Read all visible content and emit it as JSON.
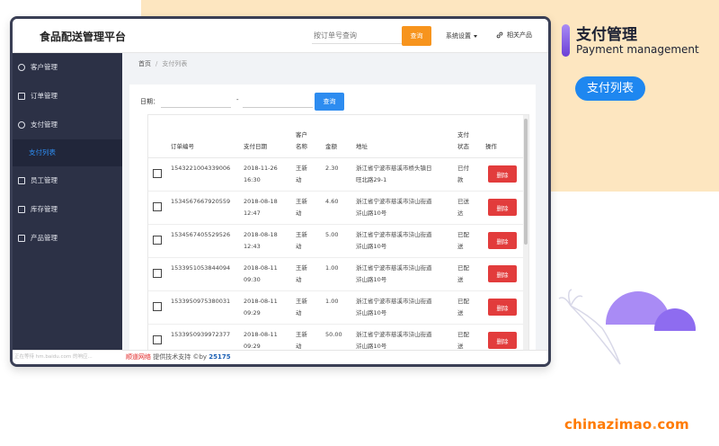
{
  "app": {
    "brand": "食品配送管理平台",
    "search_placeholder": "按订单号查询",
    "search_button": "查询",
    "system_settings": "系统设置",
    "related_products": "相关产品"
  },
  "sidebar": {
    "items": [
      {
        "label": "客户管理",
        "icon": "user-icon"
      },
      {
        "label": "订单管理",
        "icon": "document-icon"
      },
      {
        "label": "支付管理",
        "icon": "payment-icon"
      },
      {
        "label": "员工管理",
        "icon": "id-card-icon"
      },
      {
        "label": "库存管理",
        "icon": "home-icon"
      },
      {
        "label": "产品管理",
        "icon": "grid-icon"
      }
    ],
    "active_sub": "支付列表"
  },
  "breadcrumb": {
    "home": "首页",
    "sep": "/",
    "current": "支付列表"
  },
  "filter": {
    "date_label": "日期：",
    "dash": "-",
    "query_button": "查询"
  },
  "table": {
    "headers": {
      "order_no": "订单编号",
      "pay_date": "支付日期",
      "customer_l1": "客户",
      "customer_l2": "名称",
      "amount": "金额",
      "address": "地址",
      "status_l1": "支付",
      "status_l2": "状态",
      "action": "操作"
    },
    "rows": [
      {
        "order_no": "1543221004339006",
        "date": "2018-11-26",
        "time": "16:30",
        "name_l1": "王新",
        "name_l2": "动",
        "amount": "2.30",
        "addr_l1": "浙江省宁波市慈溪市桥头镇日",
        "addr_l2": "旺北路29-1",
        "status_l1": "已付",
        "status_l2": "款",
        "action": "删除"
      },
      {
        "order_no": "1534567667920559",
        "date": "2018-08-18",
        "time": "12:47",
        "name_l1": "王新",
        "name_l2": "动",
        "amount": "4.60",
        "addr_l1": "浙江省宁波市慈溪市浒山街道",
        "addr_l2": "浒山路10号",
        "status_l1": "已送",
        "status_l2": "达",
        "action": "删除"
      },
      {
        "order_no": "1534567405529526",
        "date": "2018-08-18",
        "time": "12:43",
        "name_l1": "王新",
        "name_l2": "动",
        "amount": "5.00",
        "addr_l1": "浙江省宁波市慈溪市浒山街道",
        "addr_l2": "浒山路10号",
        "status_l1": "已配",
        "status_l2": "送",
        "action": "删除"
      },
      {
        "order_no": "1533951053844094",
        "date": "2018-08-11",
        "time": "09:30",
        "name_l1": "王新",
        "name_l2": "动",
        "amount": "1.00",
        "addr_l1": "浙江省宁波市慈溪市浒山街道",
        "addr_l2": "浒山路10号",
        "status_l1": "已配",
        "status_l2": "送",
        "action": "删除"
      },
      {
        "order_no": "1533950975380031",
        "date": "2018-08-11",
        "time": "09:29",
        "name_l1": "王新",
        "name_l2": "动",
        "amount": "1.00",
        "addr_l1": "浙江省宁波市慈溪市浒山街道",
        "addr_l2": "浒山路10号",
        "status_l1": "已配",
        "status_l2": "送",
        "action": "删除"
      },
      {
        "order_no": "1533950939972377",
        "date": "2018-08-11",
        "time": "09:29",
        "name_l1": "王新",
        "name_l2": "动",
        "amount": "50.00",
        "addr_l1": "浙江省宁波市慈溪市浒山街道",
        "addr_l2": "浒山路10号",
        "status_l1": "已配",
        "status_l2": "送",
        "action": "删除"
      }
    ]
  },
  "footer": {
    "faint": "正在等待 hm.baidu.com 的响应...",
    "brand_red": "顺道网络",
    "text": "提供技术支持 ©by",
    "number": "25175"
  },
  "promo": {
    "title": "支付管理",
    "subtitle": "Payment management",
    "badge": "支付列表"
  },
  "watermark": {
    "name": "chinazimao",
    "dot": ".",
    "tld": "com"
  },
  "colors": {
    "accent_orange": "#f7941d",
    "primary_blue": "#2d8cf0",
    "danger_red": "#e23c3c",
    "sidebar_bg": "#2c3146",
    "peach_bg": "#fde6c0",
    "purple": "#a98bf5"
  }
}
